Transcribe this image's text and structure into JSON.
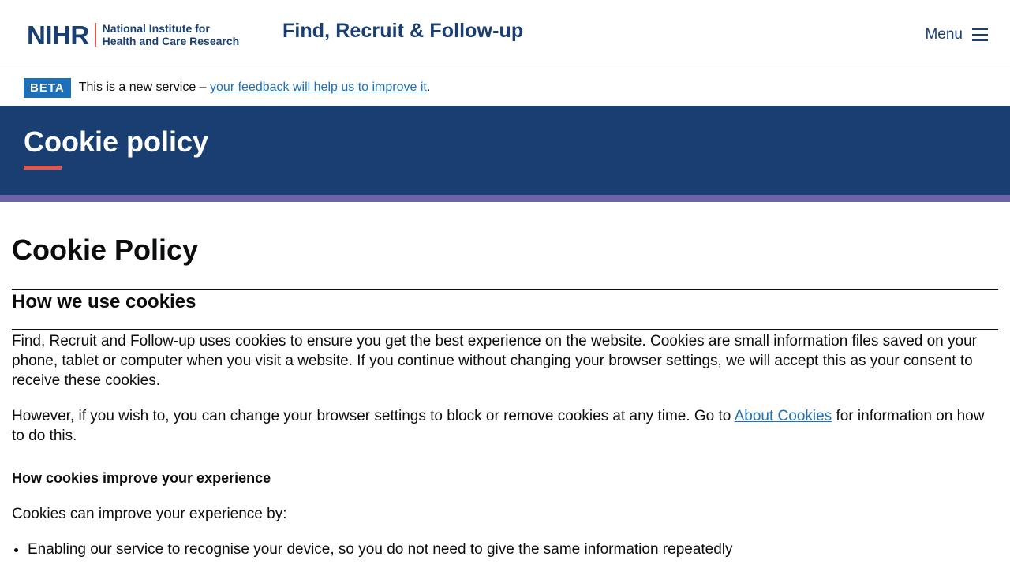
{
  "header": {
    "logo_mark": "NIHR",
    "logo_line1": "National Institute for",
    "logo_line2": "Health and Care Research",
    "service_name": "Find, Recruit & Follow-up",
    "menu_label": "Menu"
  },
  "beta": {
    "tag": "BETA",
    "text": "This is a new service – ",
    "link": "your feedback will help us to improve it",
    "suffix": "."
  },
  "hero": {
    "title": "Cookie policy"
  },
  "content": {
    "heading": "Cookie Policy",
    "section_heading": "How we use cookies",
    "para1": "Find, Recruit and Follow-up uses cookies to ensure you get the best experience on the website. Cookies are small information files saved on your phone, tablet or computer when you visit a website.  If you continue without changing your browser settings, we will accept this as your consent to receive these cookies.",
    "para2_before": "However, if you wish to, you can change your browser settings to block or remove cookies at any time. Go to ",
    "para2_link": "About Cookies",
    "para2_after": " for information on how to do this.",
    "subheading": "How cookies improve your experience",
    "para3": "Cookies can improve your experience by:",
    "list": [
      "Enabling our service to recognise your device, so you do not need to give the same information repeatedly"
    ]
  },
  "colors": {
    "brand_navy": "#193e72",
    "accent_coral": "#e5554f",
    "strip_purple": "#6b64a8",
    "link_blue": "#1d70b8"
  },
  "icons": {
    "menu": "hamburger-icon"
  }
}
